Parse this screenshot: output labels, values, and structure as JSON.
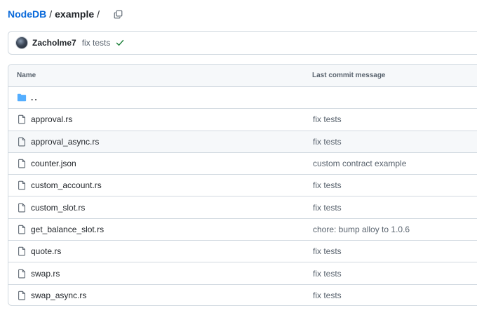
{
  "breadcrumb": {
    "repo": "NodeDB",
    "folder": "example",
    "sep": "/"
  },
  "commit": {
    "author": "Zacholme7",
    "message": "fix tests",
    "status_color": "#1a7f37"
  },
  "table": {
    "headers": {
      "name": "Name",
      "last_commit": "Last commit message"
    },
    "parent": "..",
    "rows": [
      {
        "name": "approval.rs",
        "message": "fix tests"
      },
      {
        "name": "approval_async.rs",
        "message": "fix tests"
      },
      {
        "name": "counter.json",
        "message": "custom contract example"
      },
      {
        "name": "custom_account.rs",
        "message": "fix tests"
      },
      {
        "name": "custom_slot.rs",
        "message": "fix tests"
      },
      {
        "name": "get_balance_slot.rs",
        "message": "chore: bump alloy to 1.0.6"
      },
      {
        "name": "quote.rs",
        "message": "fix tests"
      },
      {
        "name": "swap.rs",
        "message": "fix tests"
      },
      {
        "name": "swap_async.rs",
        "message": "fix tests"
      }
    ]
  },
  "colors": {
    "link": "#0969da",
    "folder": "#54aeff",
    "border": "#d1d9e0"
  }
}
